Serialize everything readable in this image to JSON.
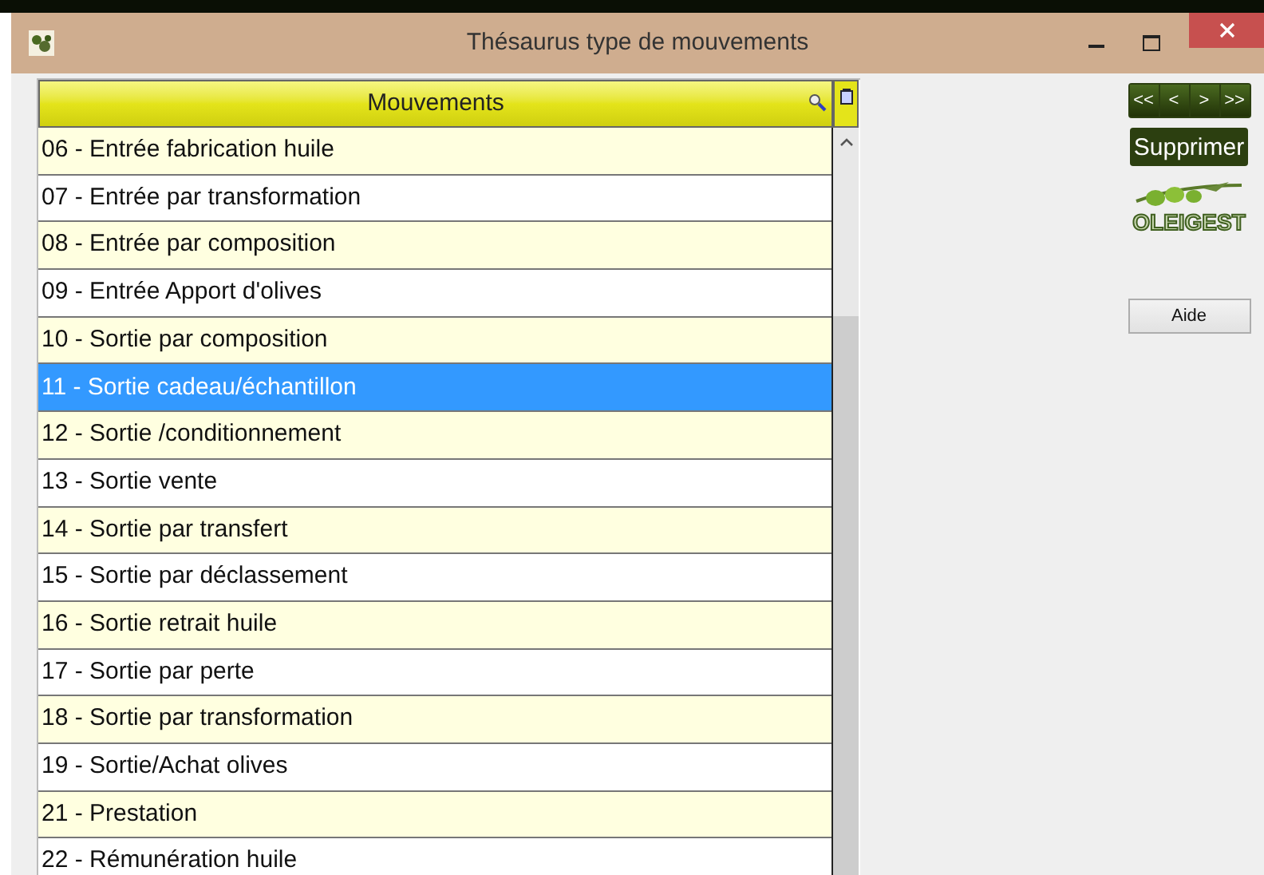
{
  "window": {
    "title": "Thésaurus type de mouvements"
  },
  "list": {
    "header": "Mouvements",
    "rows": [
      {
        "label": "06 - Entrée fabrication huile",
        "selected": false
      },
      {
        "label": "07 - Entrée par transformation",
        "selected": false
      },
      {
        "label": "08 - Entrée par composition",
        "selected": false
      },
      {
        "label": "09 - Entrée Apport d'olives",
        "selected": false
      },
      {
        "label": "10 - Sortie par composition",
        "selected": false
      },
      {
        "label": "11 - Sortie cadeau/échantillon",
        "selected": true
      },
      {
        "label": "12 - Sortie /conditionnement",
        "selected": false
      },
      {
        "label": "13 - Sortie vente",
        "selected": false
      },
      {
        "label": "14 - Sortie par transfert",
        "selected": false
      },
      {
        "label": "15 - Sortie par déclassement",
        "selected": false
      },
      {
        "label": "16 - Sortie retrait huile",
        "selected": false
      },
      {
        "label": "17 - Sortie par perte",
        "selected": false
      },
      {
        "label": "18 - Sortie par transformation",
        "selected": false
      },
      {
        "label": "19 - Sortie/Achat olives",
        "selected": false
      },
      {
        "label": "21 - Prestation",
        "selected": false
      },
      {
        "label": "22 - Rémunération huile",
        "selected": false
      }
    ]
  },
  "nav_buttons": [
    "<<",
    "<",
    ">",
    ">>"
  ],
  "delete_button": "Supprimer",
  "logo_text": "OLEIGEST",
  "help_button": "Aide"
}
